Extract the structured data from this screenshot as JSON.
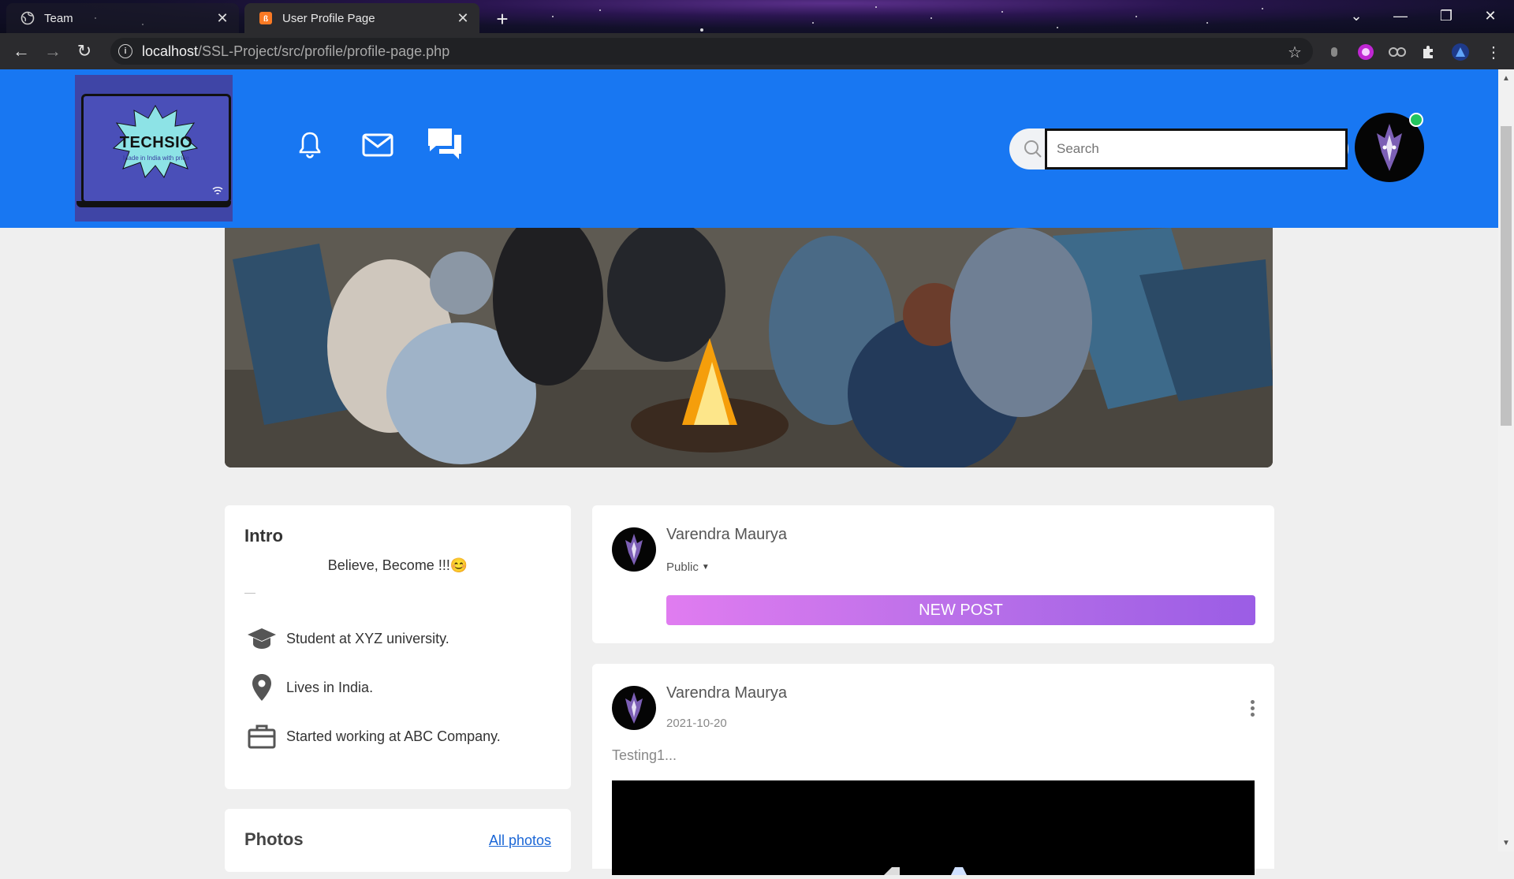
{
  "browser": {
    "tabs": [
      {
        "title": "Team",
        "active": false,
        "favicon": "globe-icon"
      },
      {
        "title": "User Profile Page",
        "active": true,
        "favicon": "xampp-icon"
      }
    ],
    "url_host": "localhost",
    "url_path": "/SSL-Project/src/profile/profile-page.php"
  },
  "header": {
    "logo_text": "TECHSIO",
    "logo_tagline": "Made in India with pride",
    "search_placeholder": "Search",
    "search_value": "",
    "icons": [
      "bell-icon",
      "mail-icon",
      "chat-icon"
    ],
    "accent_color": "#1877f2"
  },
  "intro": {
    "heading": "Intro",
    "bio": "Believe, Become !!!😊",
    "separator": "—",
    "items": [
      {
        "icon": "graduation-cap-icon",
        "text": "Student at XYZ university."
      },
      {
        "icon": "location-pin-icon",
        "text": "Lives in India."
      },
      {
        "icon": "briefcase-icon",
        "text": "Started working at ABC Company."
      }
    ]
  },
  "photos": {
    "heading": "Photos",
    "link": "All photos"
  },
  "composer": {
    "name": "Varendra Maurya",
    "privacy": "Public",
    "button": "NEW POST",
    "button_gradient": [
      "#e07cf0",
      "#9b5de5"
    ]
  },
  "post": {
    "name": "Varendra Maurya",
    "date": "2021-10-20",
    "content": "Testing1..."
  }
}
